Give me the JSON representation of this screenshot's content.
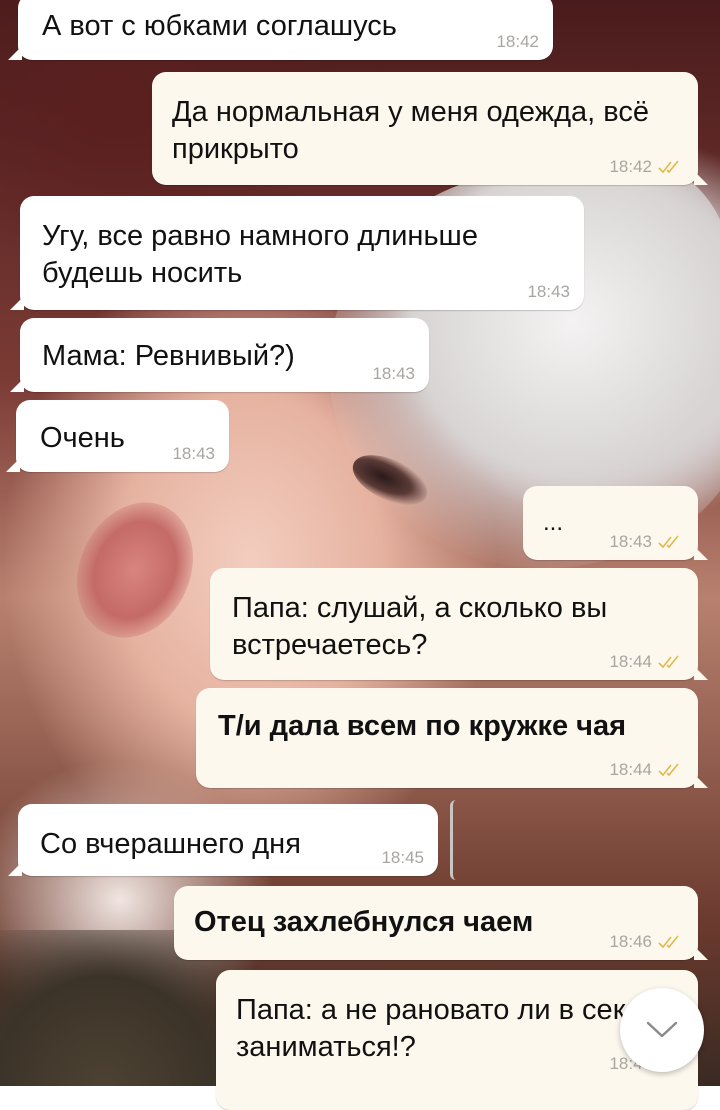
{
  "messages": [
    {
      "text": "А вот с юбками соглашусь",
      "time": "18:42"
    },
    {
      "text": "Да нормальная у меня одежда, всё прикрыто",
      "time": "18:42"
    },
    {
      "text": "Угу, все равно намного длиньше будешь носить",
      "time": "18:43"
    },
    {
      "text": "Мама: Ревнивый?)",
      "time": "18:43"
    },
    {
      "text": "Очень",
      "time": "18:43"
    },
    {
      "text": "...",
      "time": "18:43"
    },
    {
      "text": "Папа: слушай, а сколько вы встречаетесь?",
      "time": "18:44"
    },
    {
      "text": "Т/и дала всем по кружке чая",
      "time": "18:44"
    },
    {
      "text": "Со вчерашнего дня",
      "time": "18:45"
    },
    {
      "text": "Отец захлебнулся чаем",
      "time": "18:46"
    },
    {
      "text": "Папа: а не рановато ли в сексом заниматься!?",
      "time": "18:46"
    }
  ],
  "icons": {
    "read_receipt": "double-check-icon",
    "scroll_down": "chevron-down-icon"
  },
  "colors": {
    "incoming_bubble": "#ffffff",
    "outgoing_bubble": "#fdf8ee",
    "read_check": "#e3b94a",
    "timestamp": "#a8a6a2"
  }
}
